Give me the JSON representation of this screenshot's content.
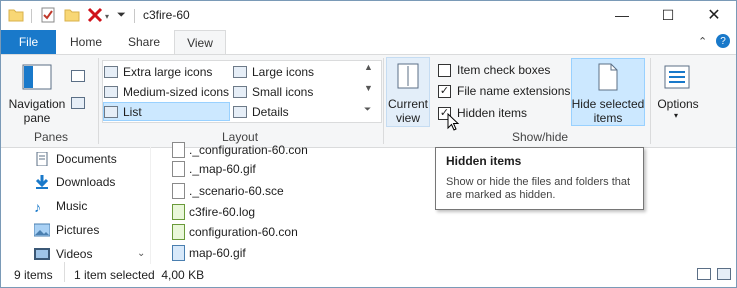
{
  "window": {
    "title": "c3fire-60"
  },
  "tabs": [
    "File",
    "Home",
    "Share",
    "View"
  ],
  "ribbon": {
    "panes": {
      "nav_pane_label": "Navigation\npane",
      "group": "Panes"
    },
    "layout": {
      "group": "Layout",
      "items": [
        "Extra large icons",
        "Large icons",
        "Medium-sized icons",
        "Small icons",
        "List",
        "Details"
      ]
    },
    "current_view": {
      "label": "Current\nview"
    },
    "showhide": {
      "group": "Show/hide",
      "item_check_boxes": "Item check boxes",
      "file_name_extensions": "File name extensions",
      "hidden_items": "Hidden items",
      "hide_selected": "Hide selected\nitems"
    },
    "options": {
      "label": "Options"
    }
  },
  "tooltip": {
    "title": "Hidden items",
    "body": "Show or hide the files and folders that are marked as hidden."
  },
  "nav": [
    "Documents",
    "Downloads",
    "Music",
    "Pictures",
    "Videos"
  ],
  "files": [
    "._configuration-60.con",
    "._map-60.gif",
    "._scenario-60.sce",
    "c3fire-60.log",
    "configuration-60.con",
    "map-60.gif"
  ],
  "status": {
    "items": "9 items",
    "selected": "1 item selected  4,00 KB"
  },
  "colors": {
    "accent": "#1979ca",
    "selected": "#cce8ff"
  }
}
